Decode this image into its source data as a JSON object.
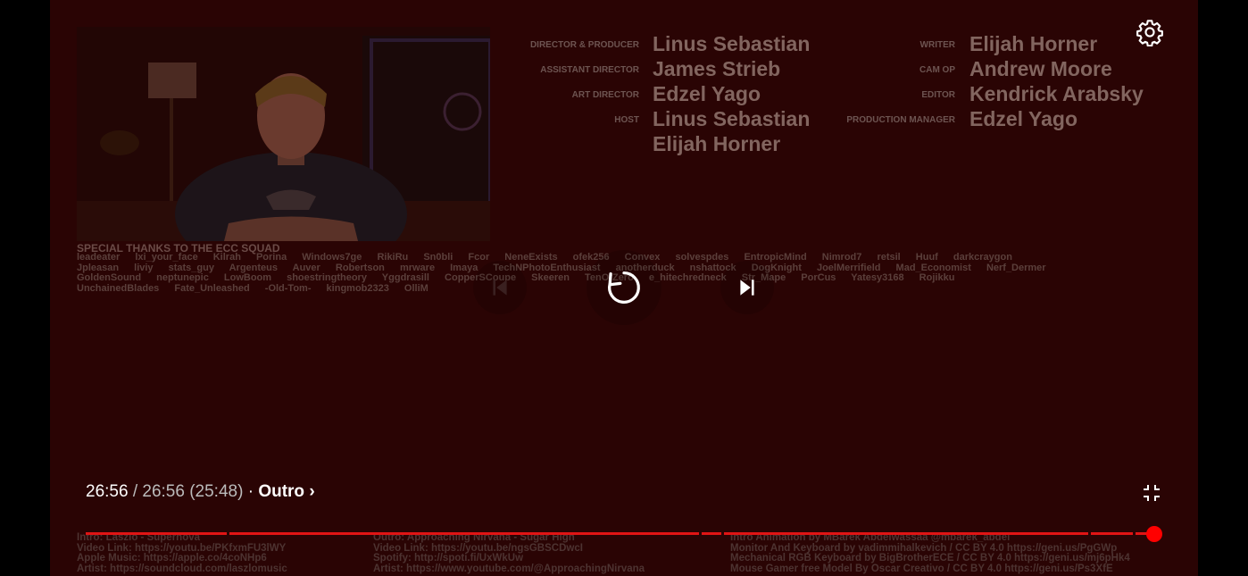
{
  "video": {
    "credits_left": [
      {
        "role": "DIRECTOR & PRODUCER",
        "name": "Linus Sebastian"
      },
      {
        "role": "ASSISTANT DIRECTOR",
        "name": "James Strieb"
      },
      {
        "role": "ART DIRECTOR",
        "name": "Edzel Yago"
      },
      {
        "role": "HOST",
        "name": "Linus Sebastian"
      },
      {
        "role": "",
        "name": "Elijah Horner"
      }
    ],
    "credits_right": [
      {
        "role": "WRITER",
        "name": "Elijah Horner"
      },
      {
        "role": "CAM OP",
        "name": "Andrew Moore"
      },
      {
        "role": "EDITOR",
        "name": "Kendrick Arabsky"
      },
      {
        "role": "PRODUCTION MANAGER",
        "name": "Edzel Yago"
      }
    ],
    "thanks_title": "SPECIAL THANKS TO THE ECC SQUAD",
    "thanks_lines": [
      "leadeater lxi_your_face Kilrah Porina Windows7ge RikiRu Sn0bli Fcor NeneExists ofek256 Convex solvespdes EntropicMind Nimrod7 retsil Huuf darkcraygon",
      "Jpleasan liviy stats_guy Argenteus Auver Robertson mrware Imaya TechNPhotoEnthusiast anotherduck nshattock DogKnight JoelMerrifield Mad_Economist Nerf_Dermer",
      "GoldenSound neptunepic LowBoom shoestringtheory Yggdrasill CopperSCoupe Skeeren TenOfZero e_hitechredneck Str_Mape PorCus Yatesy3168 Rojikku",
      "UnchainedBlades Fate_Unleashed -Old-Tom- kingmob2323 OlliM"
    ],
    "description_cols": [
      [
        "Intro: Laszlo - Supernova",
        "Video Link: https://youtu.be/PKfxmFU3lWY",
        "Apple Music: https://apple.co/4coNHp6",
        "Artist: https://soundcloud.com/laszlomusic"
      ],
      [
        "Outro: Approaching Nirvana - Sugar High",
        "Video Link: https://youtu.be/ngsGBSCDwcI",
        "Spotify: http://spoti.fi/UxWkUw",
        "Artist: https://www.youtube.com/@ApproachingNirvana"
      ],
      [
        "Intro Animation by MBarek Abdelwassaa @mbarek_abdel",
        "Monitor And Keyboard by vadimmihalkevich / CC BY 4.0 https://geni.us/PgGWp",
        "Mechanical RGB Keyboard by BigBrotherECE / CC BY 4.0 https://geni.us/mj6pHk4",
        "Mouse Gamer free Model By Oscar Creativo / CC BY 4.0 https://geni.us/Ps3XfE"
      ]
    ]
  },
  "controls": {
    "current_time": "26:56",
    "separator": " / ",
    "duration": "26:56 (25:48)",
    "dot": " · ",
    "chapter": "Outro",
    "chevron": "›",
    "progress": 1.0
  },
  "colors": {
    "progress_red": "#e01414",
    "scrubber_red": "#ff0000",
    "overlay_bg": "#2a0404"
  }
}
